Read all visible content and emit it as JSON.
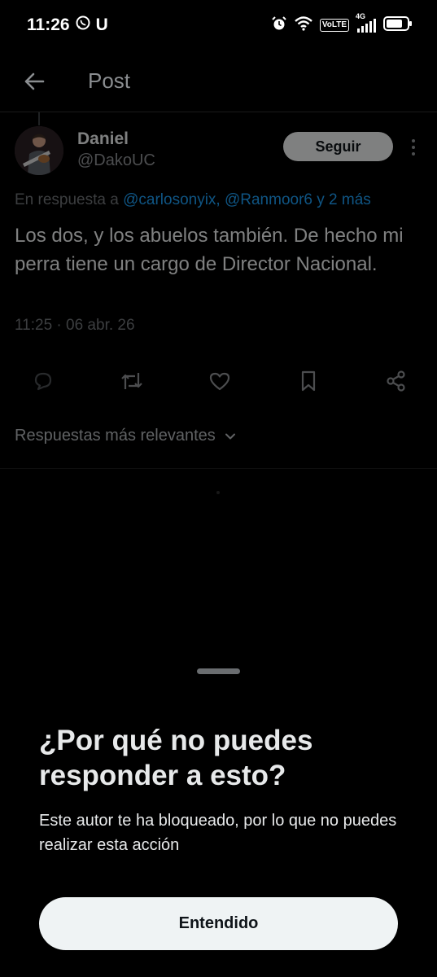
{
  "status_bar": {
    "time": "11:26",
    "carrier_icon_text": "U",
    "volte_label": "VoLTE",
    "network_label": "4G"
  },
  "header": {
    "title": "Post"
  },
  "post": {
    "author_name": "Daniel",
    "author_handle": "@DakoUC",
    "follow_label": "Seguir",
    "reply_prefix": "En respuesta a ",
    "reply_mentions": "@carlosonyix, @Ranmoor6 y 2 más",
    "text": "Los dos, y los abuelos también. De hecho mi perra tiene un cargo de Director Nacional.",
    "meta": "11:25 · 06 abr. 26"
  },
  "sort": {
    "label": "Respuestas más relevantes"
  },
  "sheet": {
    "title": "¿Por qué no puedes responder a esto?",
    "body": "Este autor te ha bloqueado, por lo que no puedes realizar esta acción",
    "button_label": "Entendido"
  },
  "colors": {
    "background": "#000000",
    "text_primary": "#e7e9ea",
    "text_secondary": "#8a8d90",
    "accent": "#1d9bf0",
    "button_bg": "#eff3f4"
  }
}
